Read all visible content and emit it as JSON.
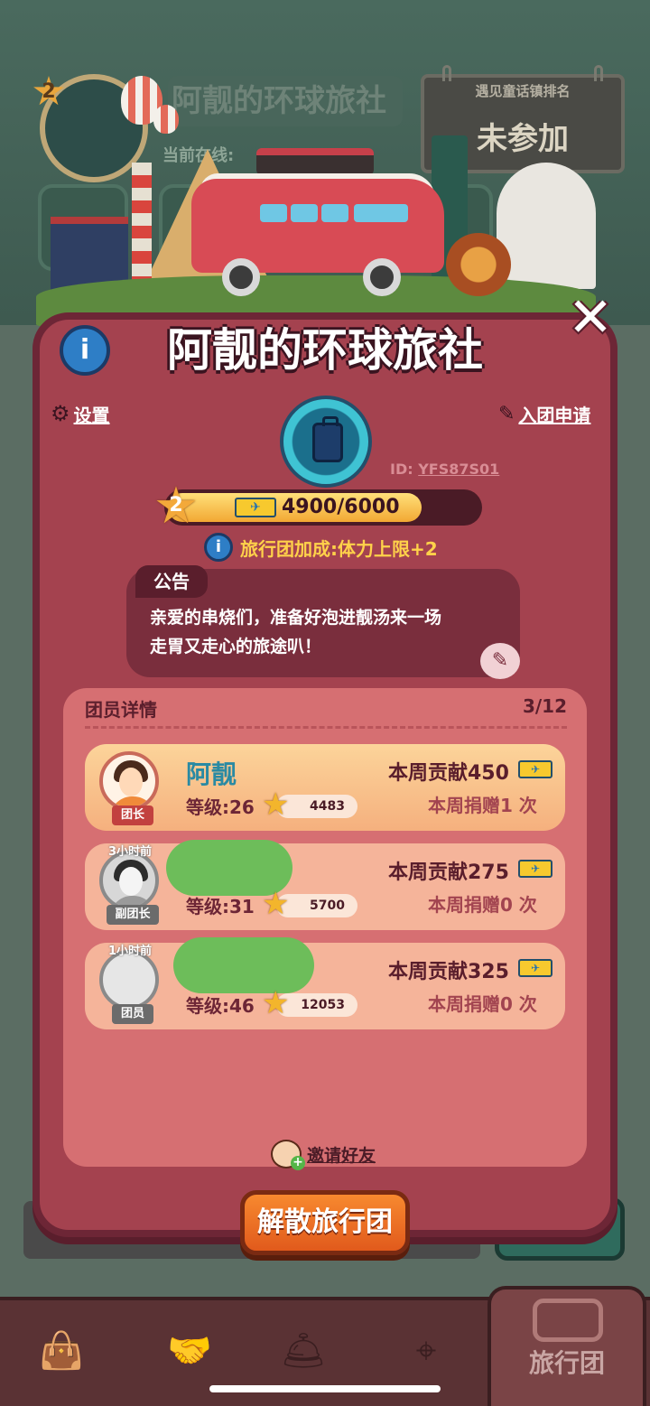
{
  "background": {
    "level": "2",
    "title": "阿靓的环球旅社",
    "online_label": "当前在线:",
    "rank_board": {
      "title": "遇见童话镇排名",
      "value": "未参加"
    }
  },
  "panel": {
    "title": "阿靓的环球旅社",
    "settings_label": "设置",
    "apply_label": "入团申请",
    "id_prefix": "ID:",
    "team_id": "YFS87S01",
    "level": "2",
    "exp_text": "4900/6000",
    "exp_progress": 0.8167,
    "bonus_text": "旅行团加成:体力上限+2"
  },
  "notice": {
    "tab_label": "公告",
    "lines": [
      "亲爱的串烧们，准备好泡进靓汤来一场",
      "走胃又走心的旅途叭！"
    ]
  },
  "members": {
    "header": "团员详情",
    "count": "3/12",
    "list": [
      {
        "name": "阿靓",
        "role": "团长",
        "last_seen": "",
        "level": "等级:26",
        "score": "4483",
        "contribution": "本周贡献450",
        "donations": "本周捐赠1 次"
      },
      {
        "name": "",
        "role": "副团长",
        "last_seen": "3小时前",
        "level": "等级:31",
        "score": "5700",
        "contribution": "本周贡献275",
        "donations": "本周捐赠0 次"
      },
      {
        "name": "",
        "role": "团员",
        "last_seen": "1小时前",
        "level": "等级:46",
        "score": "12053",
        "contribution": "本周贡献325",
        "donations": "本周捐赠0 次"
      }
    ]
  },
  "invite_label": "邀请好友",
  "disband_label": "解散旅行团",
  "nav": {
    "active_label": "旅行团"
  },
  "icons": {
    "info": "info-icon",
    "close": "close-icon",
    "gear": "gear-icon",
    "apply": "document-pen-icon",
    "ticket": "ticket-icon",
    "star": "star-icon",
    "edit": "pencil-icon"
  },
  "colors": {
    "panel": "#a4424f",
    "panel_border": "#6d2636",
    "accent_orange": "#f7892f",
    "gold": "#ffd24a",
    "team_blue": "#2a8aa3",
    "redaction_green": "#6dbd5a"
  }
}
